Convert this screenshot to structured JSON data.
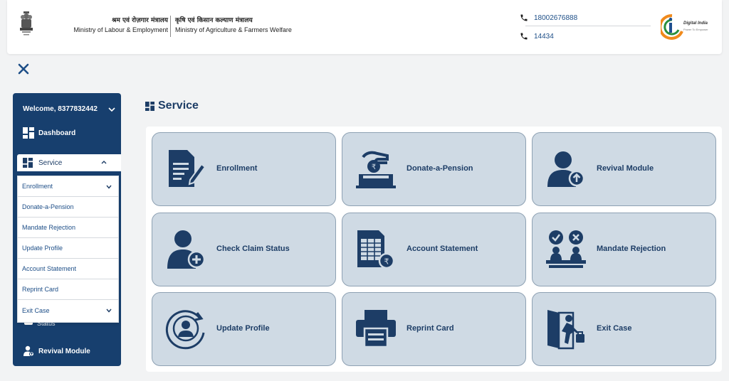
{
  "header": {
    "ministry_left_hindi": "श्रम एवं रोज़गार मंत्रालय",
    "ministry_left_english": "Ministry of Labour & Employment",
    "ministry_right_hindi": "कृषि एवं किसान कल्याण मंत्रालय",
    "ministry_right_english": "Ministry of Agriculture & Farmers Welfare",
    "phone_1": "18002676888",
    "phone_2": "14434",
    "digital_india_text": "Digital India",
    "digital_india_sub": "Power To Empower"
  },
  "sidebar": {
    "welcome": "Welcome, 8377832442",
    "dashboard_label": "Dashboard",
    "service_label": "Service",
    "hidden_status_label": "Status",
    "revival_label": "Revival Module",
    "submenu": [
      "Enrollment",
      "Donate-a-Pension",
      "Mandate Rejection",
      "Update Profile",
      "Account Statement",
      "Reprint Card",
      "Exit Case"
    ]
  },
  "main": {
    "title": "Service",
    "cards": [
      "Enrollment",
      "Donate-a-Pension",
      "Revival Module",
      "Check Claim Status",
      "Account Statement",
      "Mandate Rejection",
      "Update Profile",
      "Reprint Card",
      "Exit Case"
    ]
  },
  "colors": {
    "primary": "#173f6e",
    "card_bg": "#cfdae4",
    "card_border": "#8ea1b3",
    "icon": "#1d3d66",
    "link": "#1d4e87"
  },
  "icons": {
    "card_icons": [
      "document-pen-icon",
      "donate-coin-box-icon",
      "user-upload-icon",
      "user-add-icon",
      "ledger-rupee-icon",
      "approve-reject-icon",
      "profile-refresh-icon",
      "printer-icon",
      "exit-door-icon"
    ]
  }
}
